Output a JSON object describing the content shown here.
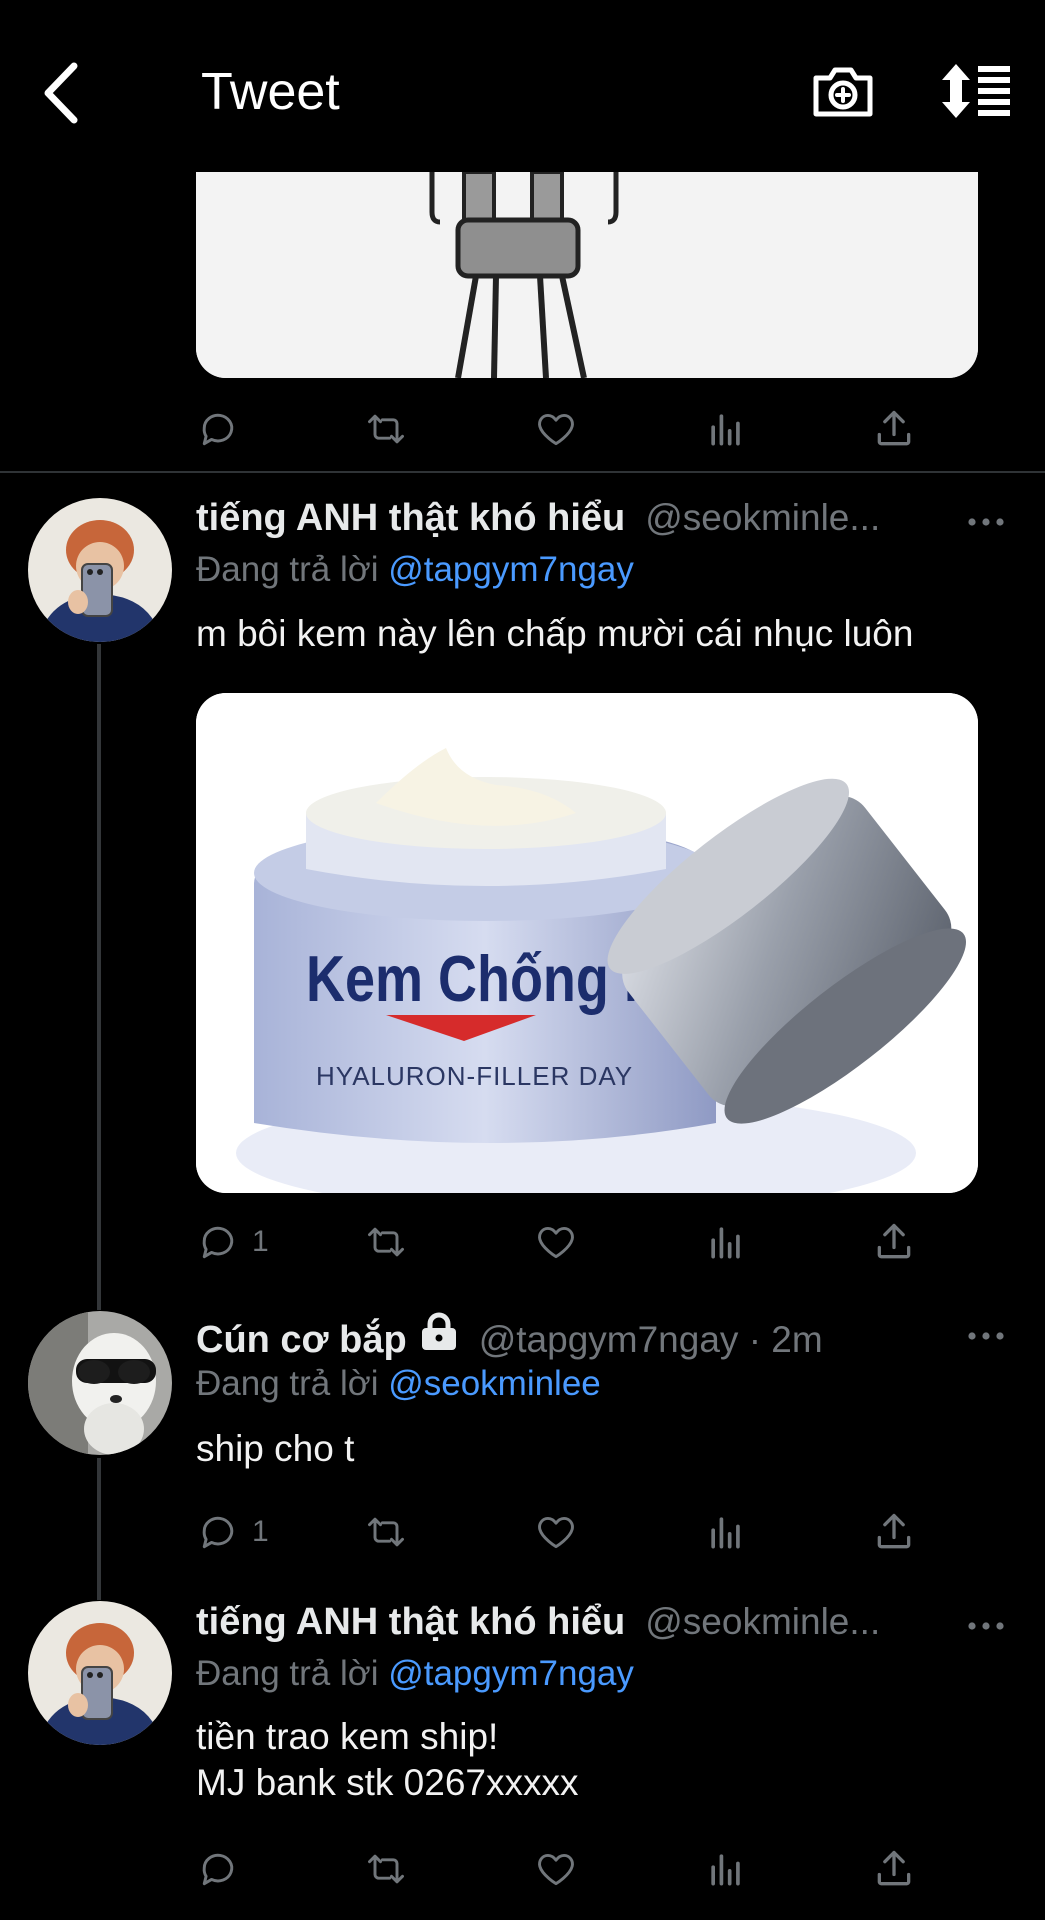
{
  "header": {
    "title": "Tweet"
  },
  "tweets": [
    {
      "name": "tiếng ANH thật khó hiểu",
      "handle": "@seokminle...",
      "reply_prefix": "Đang trả lời",
      "reply_to": "@tapgym7ngay",
      "text": "m bôi kem này lên chấp mười cái nhục luôn",
      "reply_count": "1",
      "media": {
        "line1": "Kem Chống Nhục",
        "line2": "HYALURON-FILLER DAY"
      }
    },
    {
      "name": "Cún cơ bắp",
      "handle": "@tapgym7ngay · 2m",
      "reply_prefix": "Đang trả lời",
      "reply_to": "@seokminlee",
      "text": "ship cho t",
      "reply_count": "1"
    },
    {
      "name": "tiếng ANH thật khó hiểu",
      "handle": "@seokminle...",
      "reply_prefix": "Đang trả lời",
      "reply_to": "@tapgym7ngay",
      "text": "tiền trao kem ship!\nMJ bank stk 0267xxxxx"
    }
  ],
  "icons": {
    "back": "chevron-left-icon",
    "camera": "camera-plus-icon",
    "sort": "sort-icon",
    "reply": "reply-icon",
    "retweet": "retweet-icon",
    "like": "heart-icon",
    "analytics": "analytics-icon",
    "share": "share-icon",
    "more": "more-icon",
    "lock": "lock-icon"
  },
  "colors": {
    "background": "#000000",
    "text": "#e7e9ea",
    "muted": "#71767b",
    "link": "#4a9aff"
  }
}
